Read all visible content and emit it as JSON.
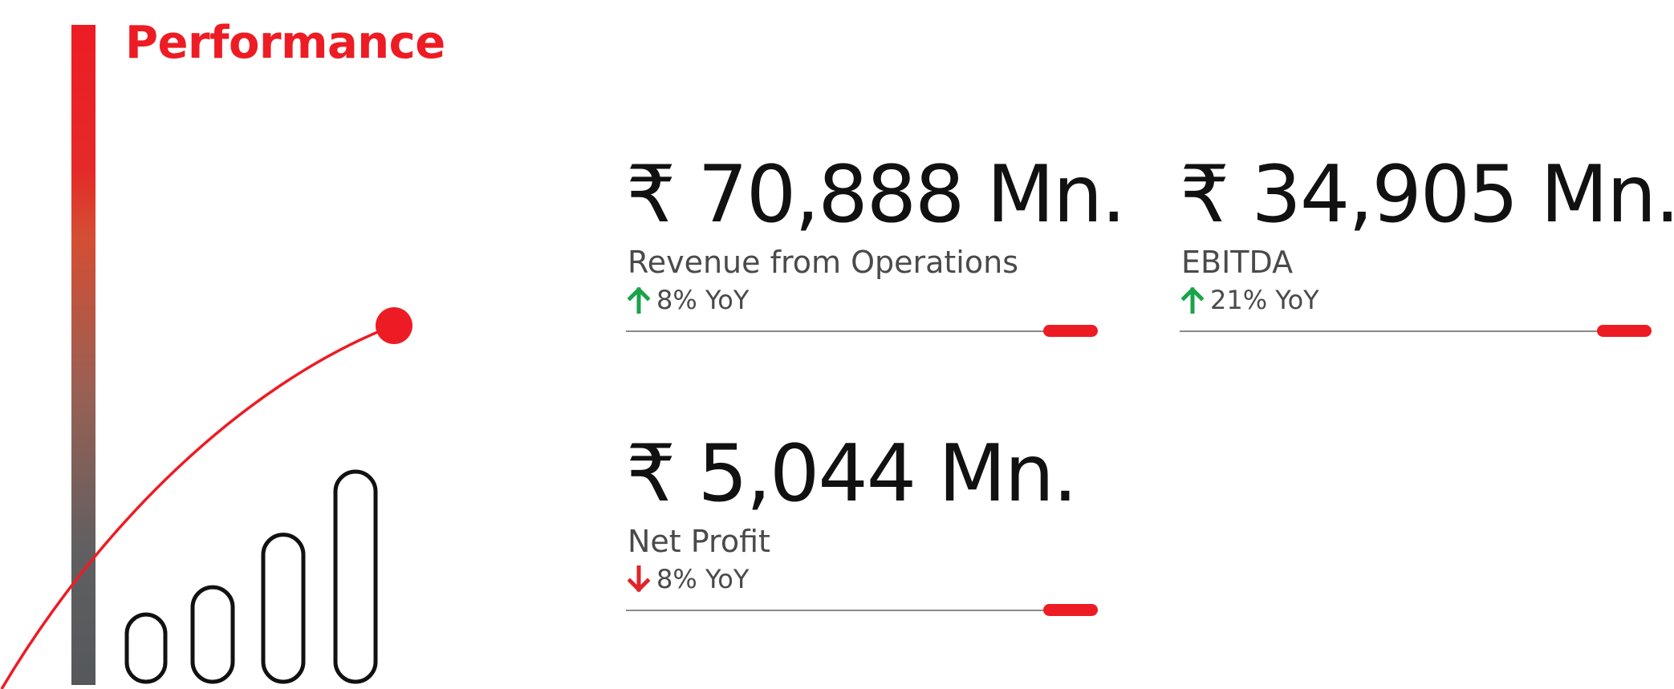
{
  "header": {
    "title": "Performance"
  },
  "colors": {
    "accent": "#ed1c24",
    "positive": "#1aa34a",
    "negative": "#e0252b",
    "text": "#111111",
    "muted": "#4a4a4a"
  },
  "graphic": {
    "icon": "growth-bars-curve-icon",
    "bar_levels": [
      0.32,
      0.45,
      0.7,
      1.0
    ]
  },
  "metrics": [
    {
      "value": "₹ 70,888 Mn.",
      "label": "Revenue from Operations",
      "change": "8% YoY",
      "direction": "up",
      "icon": "arrow-up-icon"
    },
    {
      "value": "₹ 34,905 Mn.",
      "label": "EBITDA",
      "change": "21% YoY",
      "direction": "up",
      "icon": "arrow-up-icon"
    },
    {
      "value": "₹ 5,044 Mn.",
      "label": "Net Profit",
      "change": "8% YoY",
      "direction": "down",
      "icon": "arrow-down-icon"
    }
  ]
}
